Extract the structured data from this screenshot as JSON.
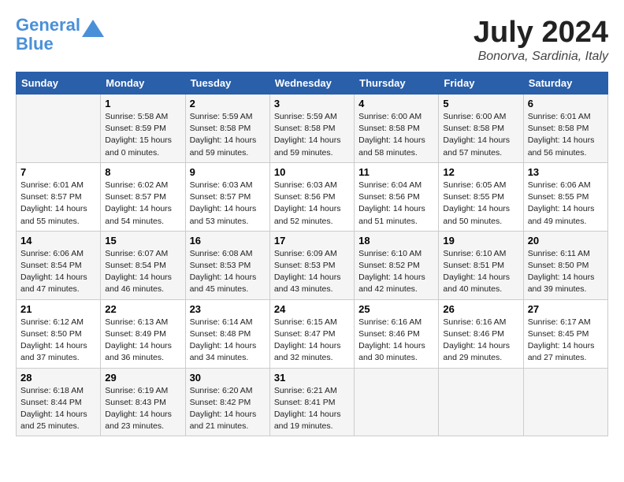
{
  "logo": {
    "line1": "General",
    "line2": "Blue"
  },
  "title": "July 2024",
  "location": "Bonorva, Sardinia, Italy",
  "days_of_week": [
    "Sunday",
    "Monday",
    "Tuesday",
    "Wednesday",
    "Thursday",
    "Friday",
    "Saturday"
  ],
  "weeks": [
    [
      {
        "day": "",
        "info": ""
      },
      {
        "day": "1",
        "info": "Sunrise: 5:58 AM\nSunset: 8:59 PM\nDaylight: 15 hours\nand 0 minutes."
      },
      {
        "day": "2",
        "info": "Sunrise: 5:59 AM\nSunset: 8:58 PM\nDaylight: 14 hours\nand 59 minutes."
      },
      {
        "day": "3",
        "info": "Sunrise: 5:59 AM\nSunset: 8:58 PM\nDaylight: 14 hours\nand 59 minutes."
      },
      {
        "day": "4",
        "info": "Sunrise: 6:00 AM\nSunset: 8:58 PM\nDaylight: 14 hours\nand 58 minutes."
      },
      {
        "day": "5",
        "info": "Sunrise: 6:00 AM\nSunset: 8:58 PM\nDaylight: 14 hours\nand 57 minutes."
      },
      {
        "day": "6",
        "info": "Sunrise: 6:01 AM\nSunset: 8:58 PM\nDaylight: 14 hours\nand 56 minutes."
      }
    ],
    [
      {
        "day": "7",
        "info": "Sunrise: 6:01 AM\nSunset: 8:57 PM\nDaylight: 14 hours\nand 55 minutes."
      },
      {
        "day": "8",
        "info": "Sunrise: 6:02 AM\nSunset: 8:57 PM\nDaylight: 14 hours\nand 54 minutes."
      },
      {
        "day": "9",
        "info": "Sunrise: 6:03 AM\nSunset: 8:57 PM\nDaylight: 14 hours\nand 53 minutes."
      },
      {
        "day": "10",
        "info": "Sunrise: 6:03 AM\nSunset: 8:56 PM\nDaylight: 14 hours\nand 52 minutes."
      },
      {
        "day": "11",
        "info": "Sunrise: 6:04 AM\nSunset: 8:56 PM\nDaylight: 14 hours\nand 51 minutes."
      },
      {
        "day": "12",
        "info": "Sunrise: 6:05 AM\nSunset: 8:55 PM\nDaylight: 14 hours\nand 50 minutes."
      },
      {
        "day": "13",
        "info": "Sunrise: 6:06 AM\nSunset: 8:55 PM\nDaylight: 14 hours\nand 49 minutes."
      }
    ],
    [
      {
        "day": "14",
        "info": "Sunrise: 6:06 AM\nSunset: 8:54 PM\nDaylight: 14 hours\nand 47 minutes."
      },
      {
        "day": "15",
        "info": "Sunrise: 6:07 AM\nSunset: 8:54 PM\nDaylight: 14 hours\nand 46 minutes."
      },
      {
        "day": "16",
        "info": "Sunrise: 6:08 AM\nSunset: 8:53 PM\nDaylight: 14 hours\nand 45 minutes."
      },
      {
        "day": "17",
        "info": "Sunrise: 6:09 AM\nSunset: 8:53 PM\nDaylight: 14 hours\nand 43 minutes."
      },
      {
        "day": "18",
        "info": "Sunrise: 6:10 AM\nSunset: 8:52 PM\nDaylight: 14 hours\nand 42 minutes."
      },
      {
        "day": "19",
        "info": "Sunrise: 6:10 AM\nSunset: 8:51 PM\nDaylight: 14 hours\nand 40 minutes."
      },
      {
        "day": "20",
        "info": "Sunrise: 6:11 AM\nSunset: 8:50 PM\nDaylight: 14 hours\nand 39 minutes."
      }
    ],
    [
      {
        "day": "21",
        "info": "Sunrise: 6:12 AM\nSunset: 8:50 PM\nDaylight: 14 hours\nand 37 minutes."
      },
      {
        "day": "22",
        "info": "Sunrise: 6:13 AM\nSunset: 8:49 PM\nDaylight: 14 hours\nand 36 minutes."
      },
      {
        "day": "23",
        "info": "Sunrise: 6:14 AM\nSunset: 8:48 PM\nDaylight: 14 hours\nand 34 minutes."
      },
      {
        "day": "24",
        "info": "Sunrise: 6:15 AM\nSunset: 8:47 PM\nDaylight: 14 hours\nand 32 minutes."
      },
      {
        "day": "25",
        "info": "Sunrise: 6:16 AM\nSunset: 8:46 PM\nDaylight: 14 hours\nand 30 minutes."
      },
      {
        "day": "26",
        "info": "Sunrise: 6:16 AM\nSunset: 8:46 PM\nDaylight: 14 hours\nand 29 minutes."
      },
      {
        "day": "27",
        "info": "Sunrise: 6:17 AM\nSunset: 8:45 PM\nDaylight: 14 hours\nand 27 minutes."
      }
    ],
    [
      {
        "day": "28",
        "info": "Sunrise: 6:18 AM\nSunset: 8:44 PM\nDaylight: 14 hours\nand 25 minutes."
      },
      {
        "day": "29",
        "info": "Sunrise: 6:19 AM\nSunset: 8:43 PM\nDaylight: 14 hours\nand 23 minutes."
      },
      {
        "day": "30",
        "info": "Sunrise: 6:20 AM\nSunset: 8:42 PM\nDaylight: 14 hours\nand 21 minutes."
      },
      {
        "day": "31",
        "info": "Sunrise: 6:21 AM\nSunset: 8:41 PM\nDaylight: 14 hours\nand 19 minutes."
      },
      {
        "day": "",
        "info": ""
      },
      {
        "day": "",
        "info": ""
      },
      {
        "day": "",
        "info": ""
      }
    ]
  ]
}
